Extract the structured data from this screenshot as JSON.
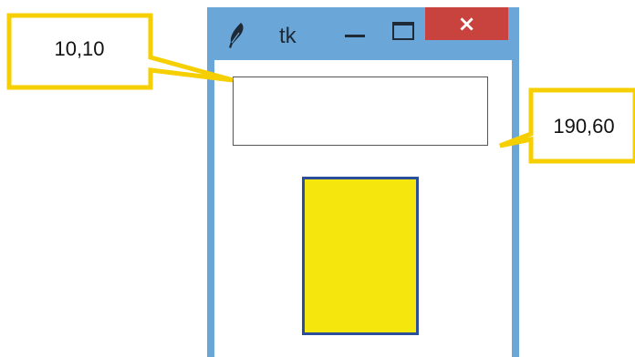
{
  "window": {
    "title": "tk",
    "close_glyph": "×",
    "icons": {
      "app": "tk-feather-icon",
      "minimize": "minimize-icon",
      "maximize": "maximize-icon",
      "close": "close-icon"
    }
  },
  "entry": {
    "value": ""
  },
  "canvas": {
    "rectangle_fill": "#f5e70d",
    "rectangle_outline": "#2c4f9c"
  },
  "annotations": {
    "top_left_label": "10,10",
    "bottom_right_label": "190,60",
    "callout_color": "#f5cf00"
  },
  "colors": {
    "window_frame": "#6aa6d8",
    "close_button": "#c9433e"
  }
}
